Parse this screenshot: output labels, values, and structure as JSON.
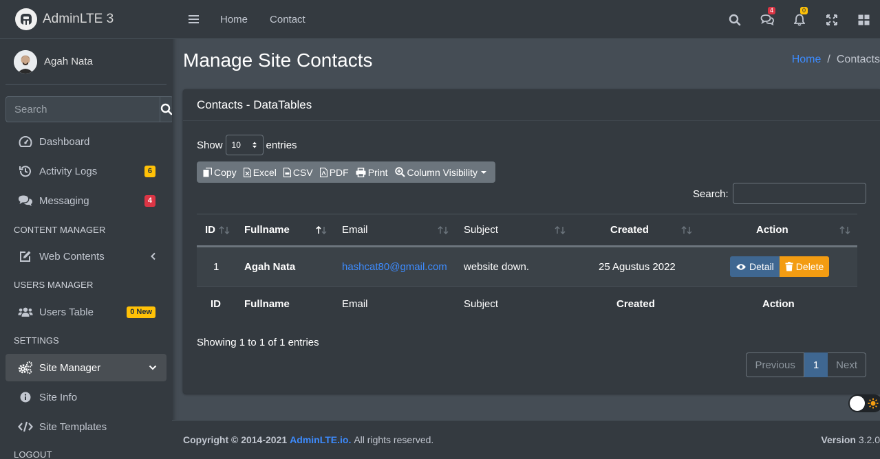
{
  "brand": {
    "name": "AdminLTE 3"
  },
  "user": {
    "name": "Agah Nata"
  },
  "sidebar": {
    "search_placeholder": "Search",
    "items": [
      {
        "label": "Dashboard"
      },
      {
        "label": "Activity Logs",
        "badge": "6"
      },
      {
        "label": "Messaging",
        "badge": "4"
      },
      {
        "header": "CONTENT MANAGER"
      },
      {
        "label": "Web Contents"
      },
      {
        "header": "USERS MANAGER"
      },
      {
        "label": "Users Table",
        "badge": "0 New"
      },
      {
        "header": "SETTINGS"
      },
      {
        "label": "Site Manager"
      },
      {
        "label": "Site Info"
      },
      {
        "label": "Site Templates"
      },
      {
        "header": "LOGOUT"
      }
    ]
  },
  "topnav": {
    "links": [
      "Home",
      "Contact"
    ],
    "messages_badge": "4",
    "notifications_badge": "0"
  },
  "page": {
    "title": "Manage Site Contacts",
    "breadcrumb": [
      "Home",
      "Contacts"
    ]
  },
  "card": {
    "title": "Contacts - DataTables",
    "show_label": "Show",
    "entries_label": "entries",
    "page_length": "10",
    "buttons": [
      "Copy",
      "Excel",
      "CSV",
      "PDF",
      "Print",
      "Column Visibility"
    ],
    "search_label": "Search:"
  },
  "table": {
    "columns": [
      "ID",
      "Fullname",
      "Email",
      "Subject",
      "Created",
      "Action"
    ],
    "rows": [
      {
        "id": "1",
        "fullname": "Agah Nata",
        "email": "hashcat80@gmail.com",
        "subject": "website down.",
        "created": "25 Agustus 2022"
      }
    ],
    "actions": {
      "detail": "Detail",
      "delete": "Delete"
    },
    "info": "Showing 1 to 1 of 1 entries",
    "pager": {
      "prev": "Previous",
      "current": "1",
      "next": "Next"
    }
  },
  "footer": {
    "copyright": "Copyright © 2014-2021",
    "link": "AdminLTE.io.",
    "rights": "All rights reserved.",
    "version_label": "Version",
    "version": "3.2.0"
  },
  "colors": {
    "sidebar_bg": "#343a40",
    "content_bg": "#454d55",
    "primary": "#3f6791",
    "warning": "#f39c12",
    "badge_warning": "#ffc107",
    "badge_danger": "#dc3545",
    "link": "#3d8bfd"
  }
}
